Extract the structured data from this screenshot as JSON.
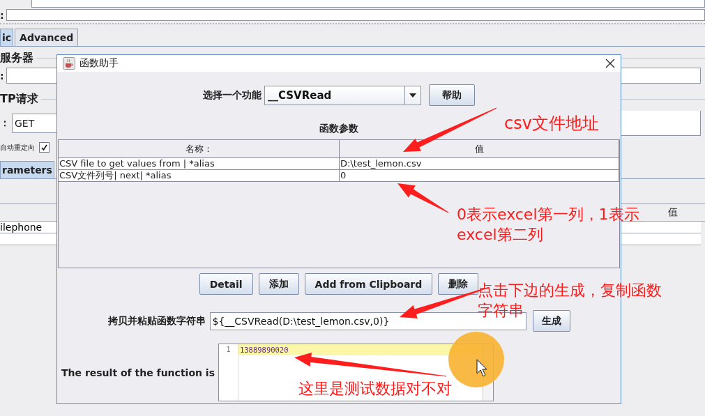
{
  "background": {
    "top_label": ":",
    "tabs": [
      {
        "label": "ic",
        "selected": true
      },
      {
        "label": "Advanced",
        "selected": false
      }
    ],
    "server_group": "服务器",
    "server_label": ":",
    "http_group": "TP请求",
    "method_label": "：",
    "method_value": "GET",
    "redirect_label": "自动重定向",
    "follow_checked": true,
    "param_tabs": [
      {
        "label": "rameters",
        "selected": true
      }
    ],
    "table_header": "值",
    "table_rows": [
      "ilephone"
    ]
  },
  "dialog": {
    "title": "函数助手",
    "function_label": "选择一个功能",
    "function_value": "__CSVRead",
    "help_button": "帮助",
    "params_title": "函数参数",
    "columns": [
      "名称：",
      "值"
    ],
    "rows": [
      {
        "name": "CSV file to get values from | *alias",
        "value": "D:\\test_lemon.csv"
      },
      {
        "name": "CSV文件列号| next| *alias",
        "value": "0"
      }
    ],
    "buttons": [
      "Detail",
      "添加",
      "Add from Clipboard",
      "删除"
    ],
    "string_label": "拷贝并粘贴函数字符串",
    "string_value": "${__CSVRead(D:\\test_lemon.csv,0)}",
    "generate_button": "生成",
    "result_label": "The result of the function is",
    "result_lines": [
      {
        "number": "1",
        "text": "13889890020"
      }
    ]
  },
  "annotations": [
    {
      "lines": [
        "csv文件地址"
      ]
    },
    {
      "lines": [
        "0表示excel第一列，1表示",
        "excel第二列"
      ]
    },
    {
      "lines": [
        "点击下边的生成，复制函数",
        "字符串"
      ]
    },
    {
      "lines": [
        "这里是测试数据对不对"
      ]
    }
  ]
}
